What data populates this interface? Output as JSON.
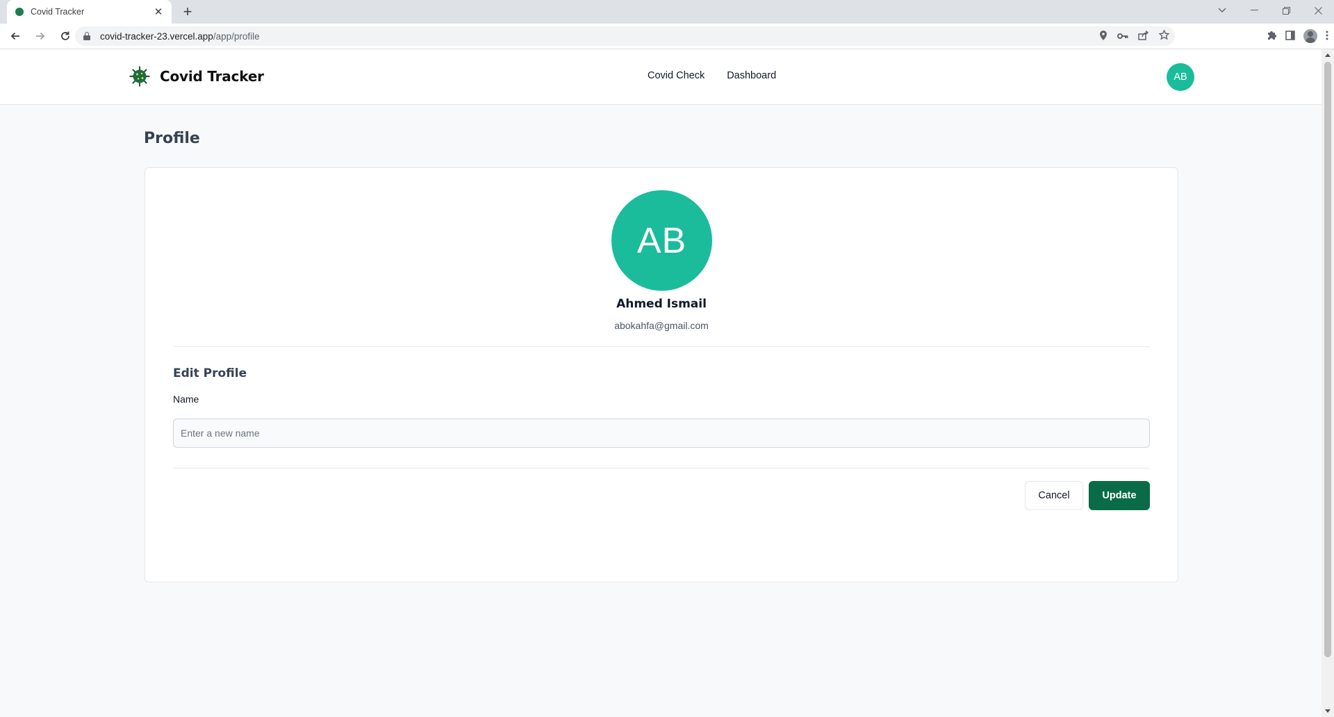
{
  "browser": {
    "tab_title": "Covid Tracker",
    "tab_close": "✕",
    "new_tab": "+",
    "url_host": "covid-tracker-23.vercel.app",
    "url_path": "/app/profile"
  },
  "header": {
    "brand": "Covid Tracker",
    "nav": [
      "Covid Check",
      "Dashboard"
    ],
    "avatar_initials": "AB"
  },
  "page": {
    "title": "Profile"
  },
  "profile": {
    "initials": "AB",
    "name": "Ahmed Ismail",
    "email": "abokahfa@gmail.com"
  },
  "edit": {
    "title": "Edit Profile",
    "name_label": "Name",
    "name_placeholder": "Enter a new name",
    "name_value": "",
    "cancel_label": "Cancel",
    "update_label": "Update"
  },
  "colors": {
    "accent": "#1bbc9b",
    "primary_button": "#0a6b48",
    "page_background": "#f8f9fb"
  },
  "icons": {
    "brand_logo": "virus-icon",
    "location": "location-icon",
    "password": "key-icon",
    "share": "share-icon",
    "bookmark": "star-icon",
    "extensions": "puzzle-icon",
    "side_panel": "side-panel-icon",
    "profile": "profile-icon",
    "menu": "kebab-menu-icon"
  }
}
